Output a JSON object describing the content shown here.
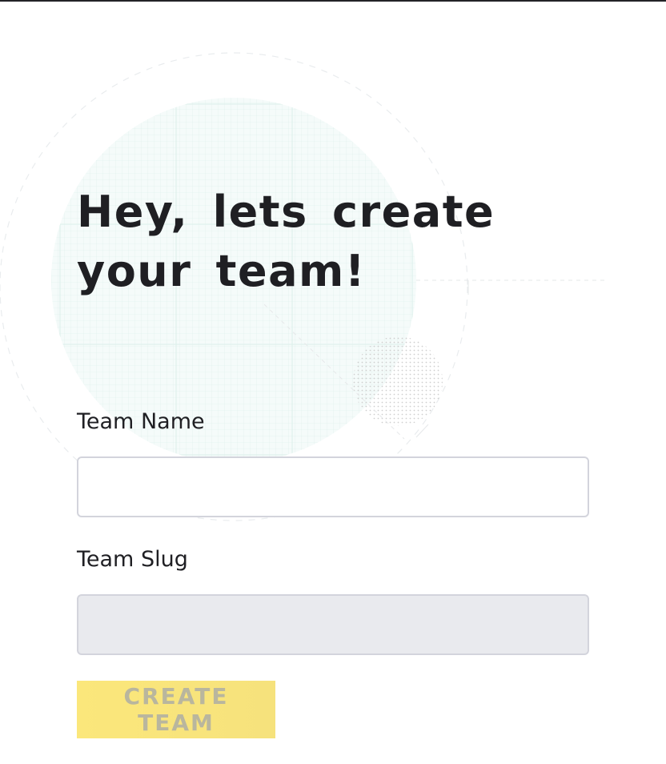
{
  "page": {
    "heading": "Hey, lets create your team!"
  },
  "form": {
    "team_name": {
      "label": "Team Name",
      "value": "",
      "placeholder": ""
    },
    "team_slug": {
      "label": "Team Slug",
      "value": "",
      "placeholder": "",
      "disabled": true
    },
    "submit": {
      "label": "CREATE TEAM",
      "disabled": true
    }
  },
  "colors": {
    "text": "#1f1f23",
    "button_bg": "#fbe77b",
    "button_text_disabled": "#b9b69e",
    "input_border": "#d3d4dc",
    "input_disabled_bg": "#e9eaee"
  }
}
